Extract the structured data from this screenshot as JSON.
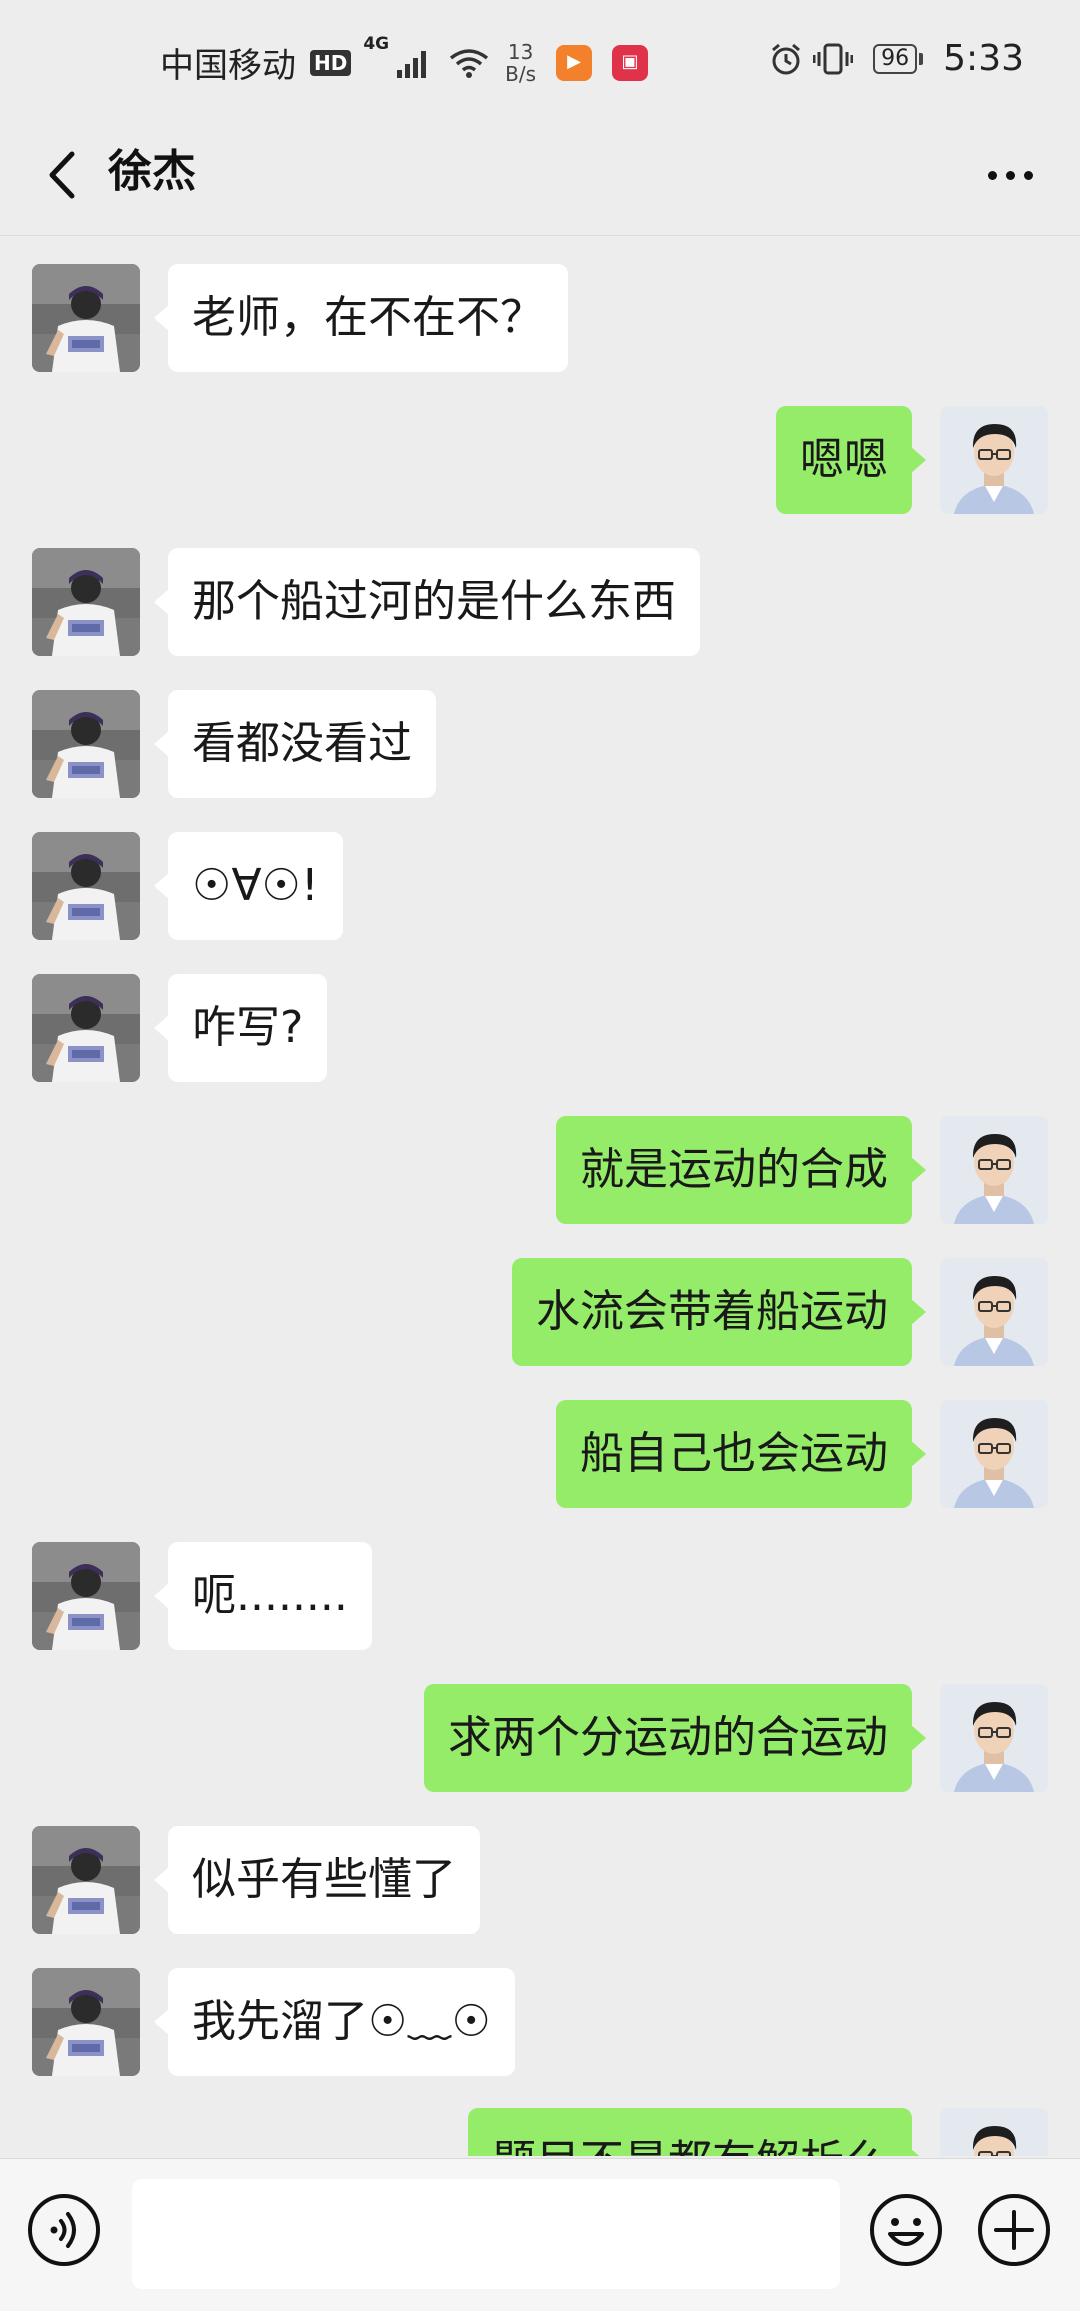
{
  "status_bar": {
    "carrier": "中国移动",
    "hd": "HD",
    "network": "4G",
    "speed_value": "13",
    "speed_unit": "B/s",
    "battery": "96",
    "time": "5:33"
  },
  "header": {
    "title": "徐杰"
  },
  "messages": [
    {
      "side": "in",
      "text": "老师，在不在不？"
    },
    {
      "side": "out",
      "text": "嗯嗯"
    },
    {
      "side": "in",
      "text": "那个船过河的是什么东西"
    },
    {
      "side": "in",
      "text": "看都没看过"
    },
    {
      "side": "in",
      "text": "☉∀☉!"
    },
    {
      "side": "in",
      "text": "咋写?"
    },
    {
      "side": "out",
      "text": "就是运动的合成"
    },
    {
      "side": "out",
      "text": "水流会带着船运动"
    },
    {
      "side": "out",
      "text": "船自己也会运动"
    },
    {
      "side": "in",
      "text": "呃........"
    },
    {
      "side": "out",
      "text": "求两个分运动的合运动"
    },
    {
      "side": "in",
      "text": "似乎有些懂了"
    },
    {
      "side": "in",
      "text": "我先溜了☉﹏☉"
    },
    {
      "side": "out",
      "text": "题目不是都有解析么"
    }
  ],
  "input_bar": {
    "placeholder": ""
  },
  "colors": {
    "background": "#ededed",
    "sent_bubble": "#95ec69",
    "received_bubble": "#ffffff"
  }
}
